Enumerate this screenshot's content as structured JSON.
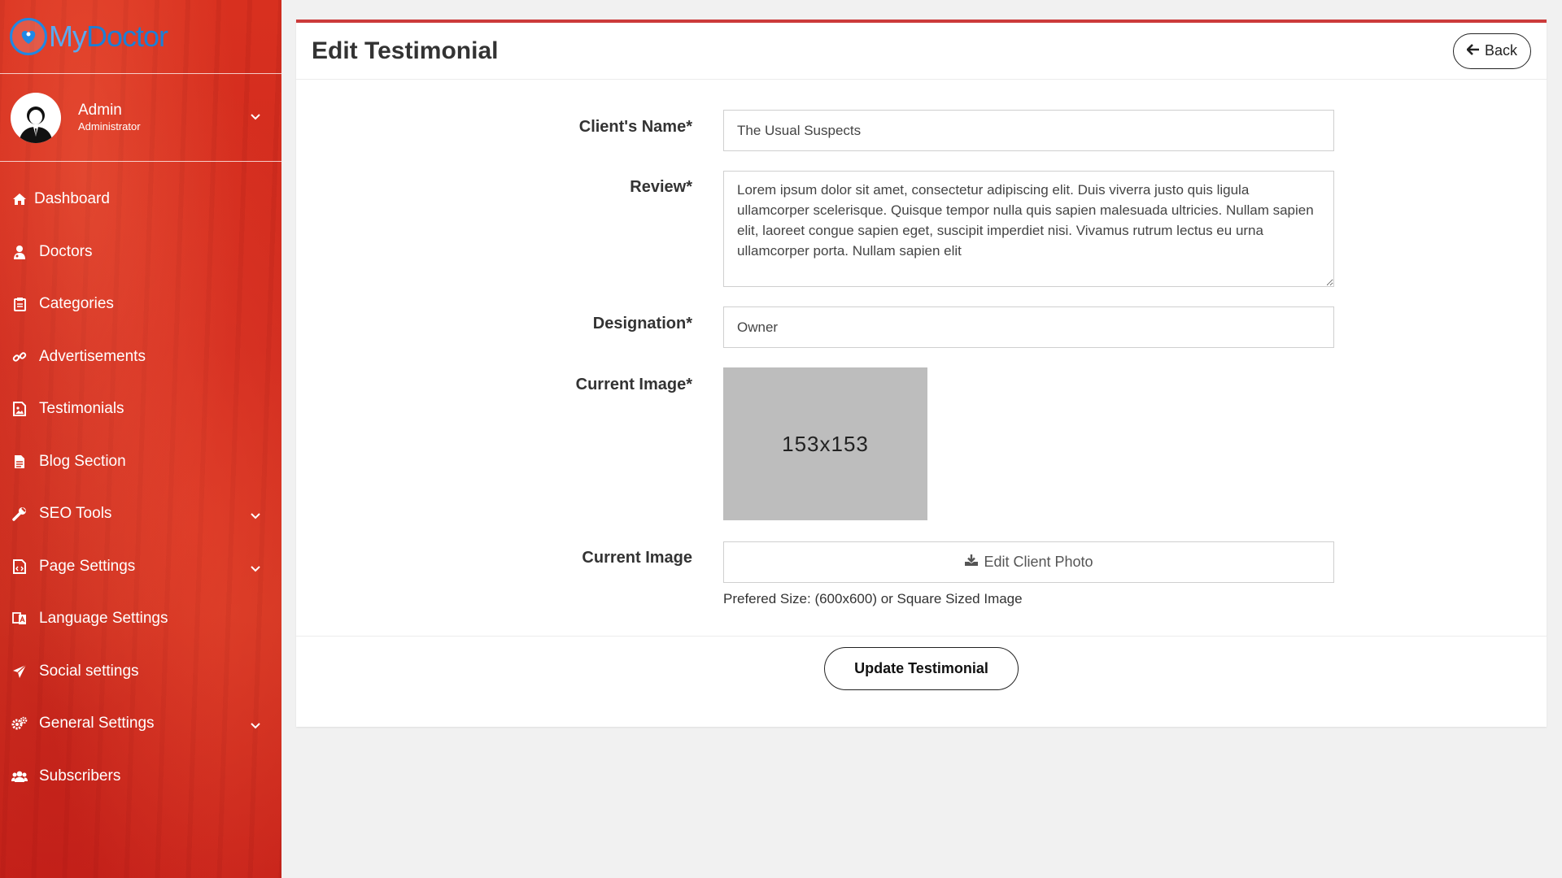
{
  "brand": {
    "name_part1": "My",
    "name_part2": "Doctor",
    "color": "#1c7fd6"
  },
  "user": {
    "name": "Admin",
    "role": "Administrator"
  },
  "sidebar": {
    "items": [
      {
        "label": "Dashboard",
        "icon": "home-icon",
        "expandable": false
      },
      {
        "label": "Doctors",
        "icon": "user-md-icon",
        "expandable": false
      },
      {
        "label": "Categories",
        "icon": "clipboard-icon",
        "expandable": false
      },
      {
        "label": "Advertisements",
        "icon": "link-icon",
        "expandable": false
      },
      {
        "label": "Testimonials",
        "icon": "image-icon",
        "expandable": false
      },
      {
        "label": "Blog Section",
        "icon": "file-icon",
        "expandable": false
      },
      {
        "label": "SEO Tools",
        "icon": "wrench-icon",
        "expandable": true
      },
      {
        "label": "Page Settings",
        "icon": "file-code-icon",
        "expandable": true
      },
      {
        "label": "Language Settings",
        "icon": "language-icon",
        "expandable": false
      },
      {
        "label": "Social settings",
        "icon": "paper-plane-icon",
        "expandable": false
      },
      {
        "label": "General Settings",
        "icon": "cogs-icon",
        "expandable": true
      },
      {
        "label": "Subscribers",
        "icon": "users-icon",
        "expandable": false
      }
    ]
  },
  "header": {
    "title": "Edit Testimonial",
    "back_label": "Back"
  },
  "form": {
    "client_name": {
      "label": "Client's Name*",
      "value": "The Usual Suspects"
    },
    "review": {
      "label": "Review*",
      "value": "Lorem ipsum dolor sit amet, consectetur adipiscing elit. Duis viverra justo quis ligula ullamcorper scelerisque. Quisque tempor nulla quis sapien malesuada ultricies. Nullam sapien elit, laoreet congue sapien eget, suscipit imperdiet nisi. Vivamus rutrum lectus eu urna ullamcorper porta. Nullam sapien elit"
    },
    "designation": {
      "label": "Designation*",
      "value": "Owner"
    },
    "current_image": {
      "label": "Current Image*",
      "placeholder_text": "153x153"
    },
    "upload": {
      "label": "Current Image",
      "button_label": "Edit Client Photo",
      "help_text": "Prefered Size: (600x600) or Square Sized Image"
    },
    "submit_label": "Update Testimonial"
  },
  "colors": {
    "sidebar_bg": "#d23522",
    "accent": "#cc3b3b"
  }
}
